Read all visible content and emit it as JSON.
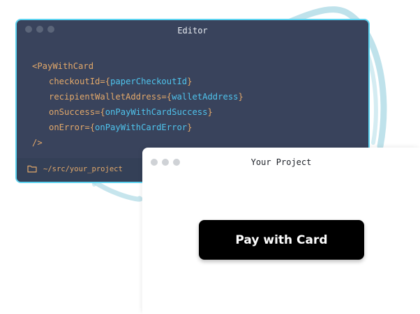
{
  "editor": {
    "title": "Editor",
    "code": {
      "open_tag": "<PayWithCard",
      "props": [
        {
          "attr": "checkoutId=",
          "value": "paperCheckoutId"
        },
        {
          "attr": "recipientWalletAddress=",
          "value": "walletAddress"
        },
        {
          "attr": "onSuccess=",
          "value": "onPayWithCardSuccess"
        },
        {
          "attr": "onError=",
          "value": "onPayWithCardError"
        }
      ],
      "close_tag": "/>"
    },
    "footer": {
      "icon": "folder-icon",
      "path": "~/src/your_project"
    }
  },
  "project": {
    "title": "Your Project",
    "pay_button_label": "Pay with Card"
  },
  "colors": {
    "editor_bg": "#39435c",
    "editor_border": "#5cd3f0",
    "code_orange": "#e2a86a",
    "code_blue": "#4fc3ec",
    "button_bg": "#000000"
  }
}
